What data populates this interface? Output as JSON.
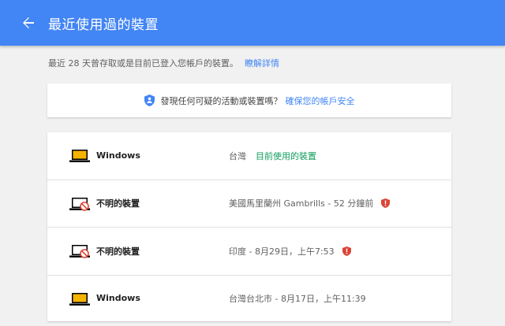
{
  "header": {
    "title": "最近使用過的裝置",
    "back_icon": "arrow-back-icon"
  },
  "intro": {
    "text": "最近 28 天曾存取或是目前已登入您帳戶的裝置。",
    "link": "瞭解詳情"
  },
  "security_prompt": {
    "icon": "shield-icon",
    "text": "發現任何可疑的活動或裝置嗎？",
    "link": "確保您的帳戶安全"
  },
  "devices": [
    {
      "name": "Windows",
      "location": "台灣",
      "badge": "目前使用的裝置",
      "icon": "laptop-icon",
      "warning": false
    },
    {
      "name": "不明的裝置",
      "location": "美國馬里蘭州 Gambrills - 52 分鐘前",
      "badge": "",
      "icon": "unknown-device-icon",
      "warning": true
    },
    {
      "name": "不明的裝置",
      "location": "印度 - 8月29日，上午7:53",
      "badge": "",
      "icon": "unknown-device-icon",
      "warning": true
    },
    {
      "name": "Windows",
      "location": "台灣台北市 - 8月17日，上午11:39",
      "badge": "",
      "icon": "laptop-icon",
      "warning": false
    }
  ],
  "colors": {
    "header_bg": "#4285f4",
    "link": "#4285f4",
    "current_badge": "#0f9d58",
    "warning": "#db4437",
    "laptop_screen": "#f4b400"
  }
}
